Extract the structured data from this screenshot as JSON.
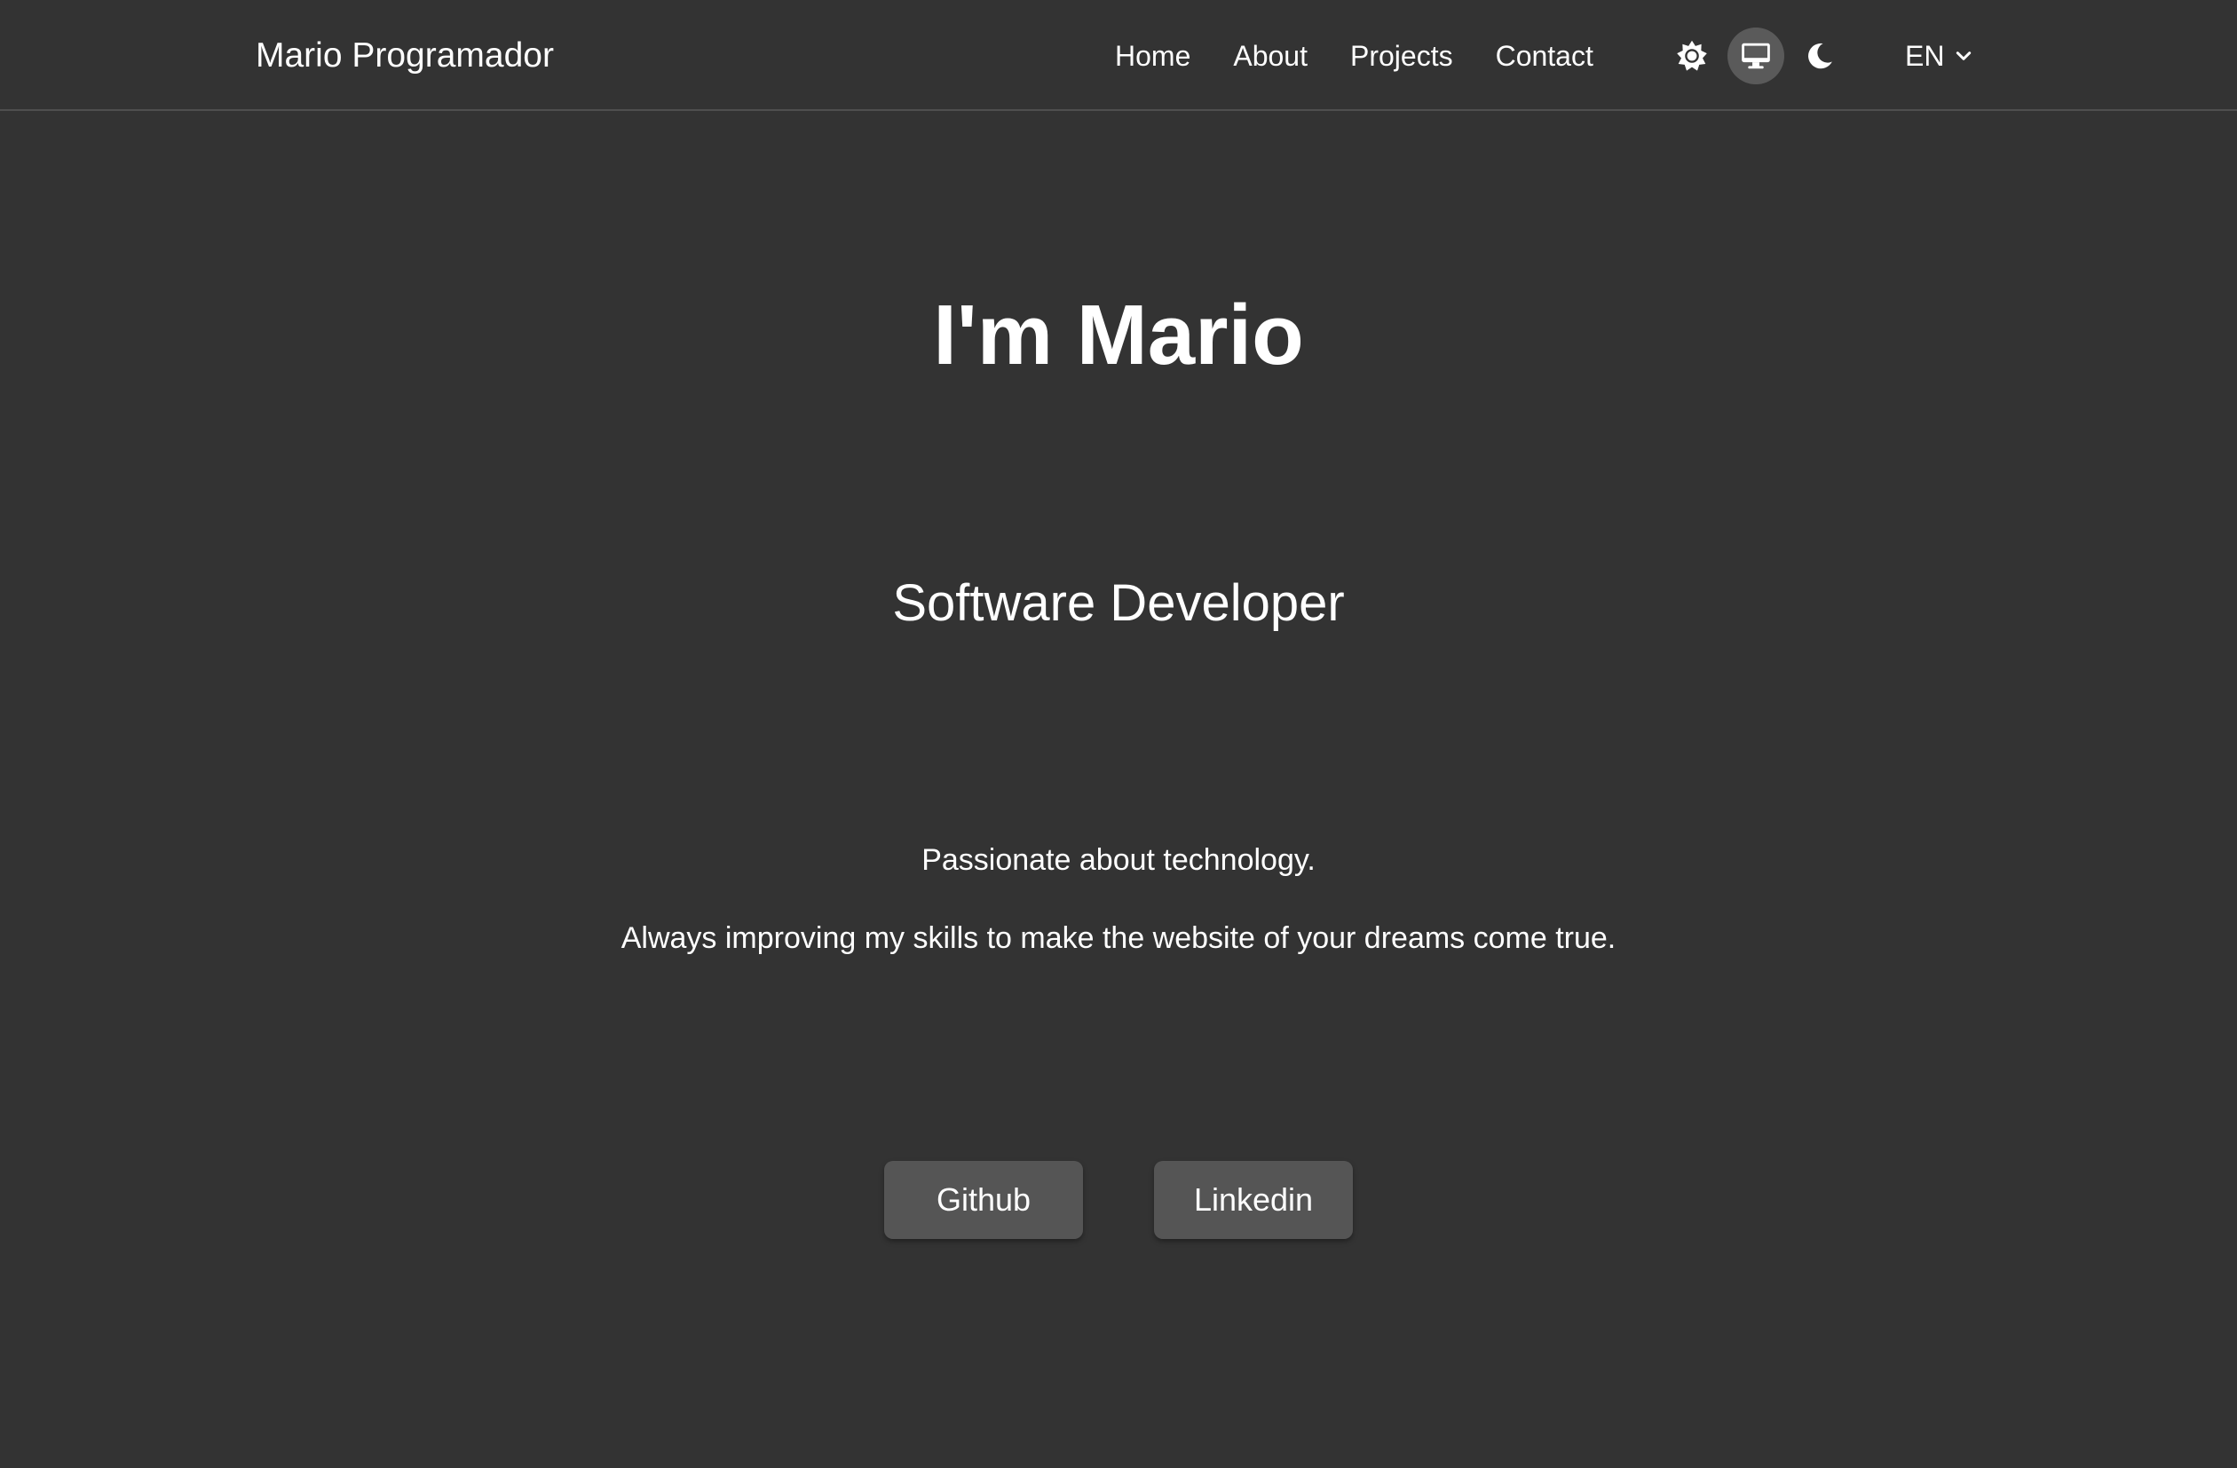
{
  "header": {
    "brand": "Mario Programador",
    "nav": [
      {
        "label": "Home"
      },
      {
        "label": "About"
      },
      {
        "label": "Projects"
      },
      {
        "label": "Contact"
      }
    ],
    "theme_switch": {
      "options": [
        {
          "icon": "sun-icon",
          "active": false
        },
        {
          "icon": "monitor-icon",
          "active": true
        },
        {
          "icon": "moon-icon",
          "active": false
        }
      ]
    },
    "language": {
      "selected": "EN",
      "icon": "chevron-down-icon"
    }
  },
  "hero": {
    "title": "I'm Mario",
    "subtitle": "Software Developer",
    "lines": [
      "Passionate about technology.",
      "Always improving my skills to make the website of your dreams come true."
    ],
    "buttons": [
      {
        "label": "Github"
      },
      {
        "label": "Linkedin"
      }
    ]
  },
  "colors": {
    "background": "#333333",
    "text": "#ffffff",
    "button_bg": "#555555",
    "active_toggle_bg": "#5a5a5a",
    "divider": "#4f4f4f"
  }
}
